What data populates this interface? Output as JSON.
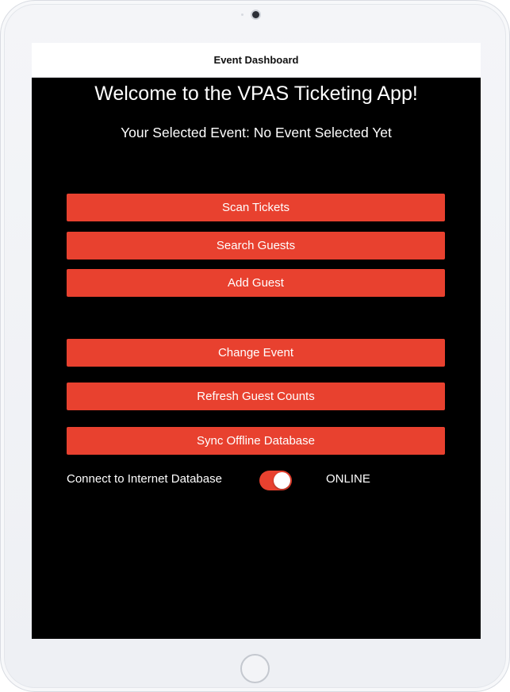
{
  "nav": {
    "title": "Event Dashboard"
  },
  "main": {
    "welcome": "Welcome to the VPAS Ticketing App!",
    "selected_event": "Your Selected Event: No Event Selected Yet"
  },
  "buttons": {
    "scan_tickets": "Scan Tickets",
    "search_guests": "Search Guests",
    "add_guest": "Add Guest",
    "change_event": "Change Event",
    "refresh_guest_counts": "Refresh Guest Counts",
    "sync_offline_database": "Sync Offline Database"
  },
  "connection": {
    "label": "Connect to Internet Database",
    "toggle_on": true,
    "status": "ONLINE"
  },
  "colors": {
    "accent": "#e8412f",
    "background": "#000000",
    "nav_background": "#ffffff"
  }
}
